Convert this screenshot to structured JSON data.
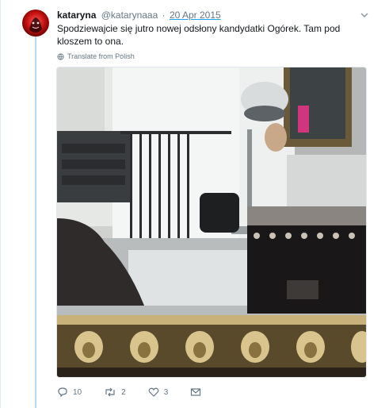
{
  "tweet": {
    "display_name": "kataryna",
    "handle": "@katarynaaa",
    "separator": "·",
    "date": "20 Apr 2015",
    "text": "Spodziewajcie się jutro nowej odsłony kandydatki Ogórek. Tam pod kloszem to ona.",
    "translate_label": "Translate from Polish"
  },
  "actions": {
    "reply_count": "10",
    "retweet_count": "2",
    "like_count": "3"
  },
  "icons": [
    "chevron-down-icon",
    "globe-icon",
    "reply-icon",
    "retweet-icon",
    "heart-icon",
    "message-icon"
  ],
  "colors": {
    "link_blue": "#1da1f2",
    "thread_line": "#b8d9f1",
    "secondary_text": "#657786"
  }
}
